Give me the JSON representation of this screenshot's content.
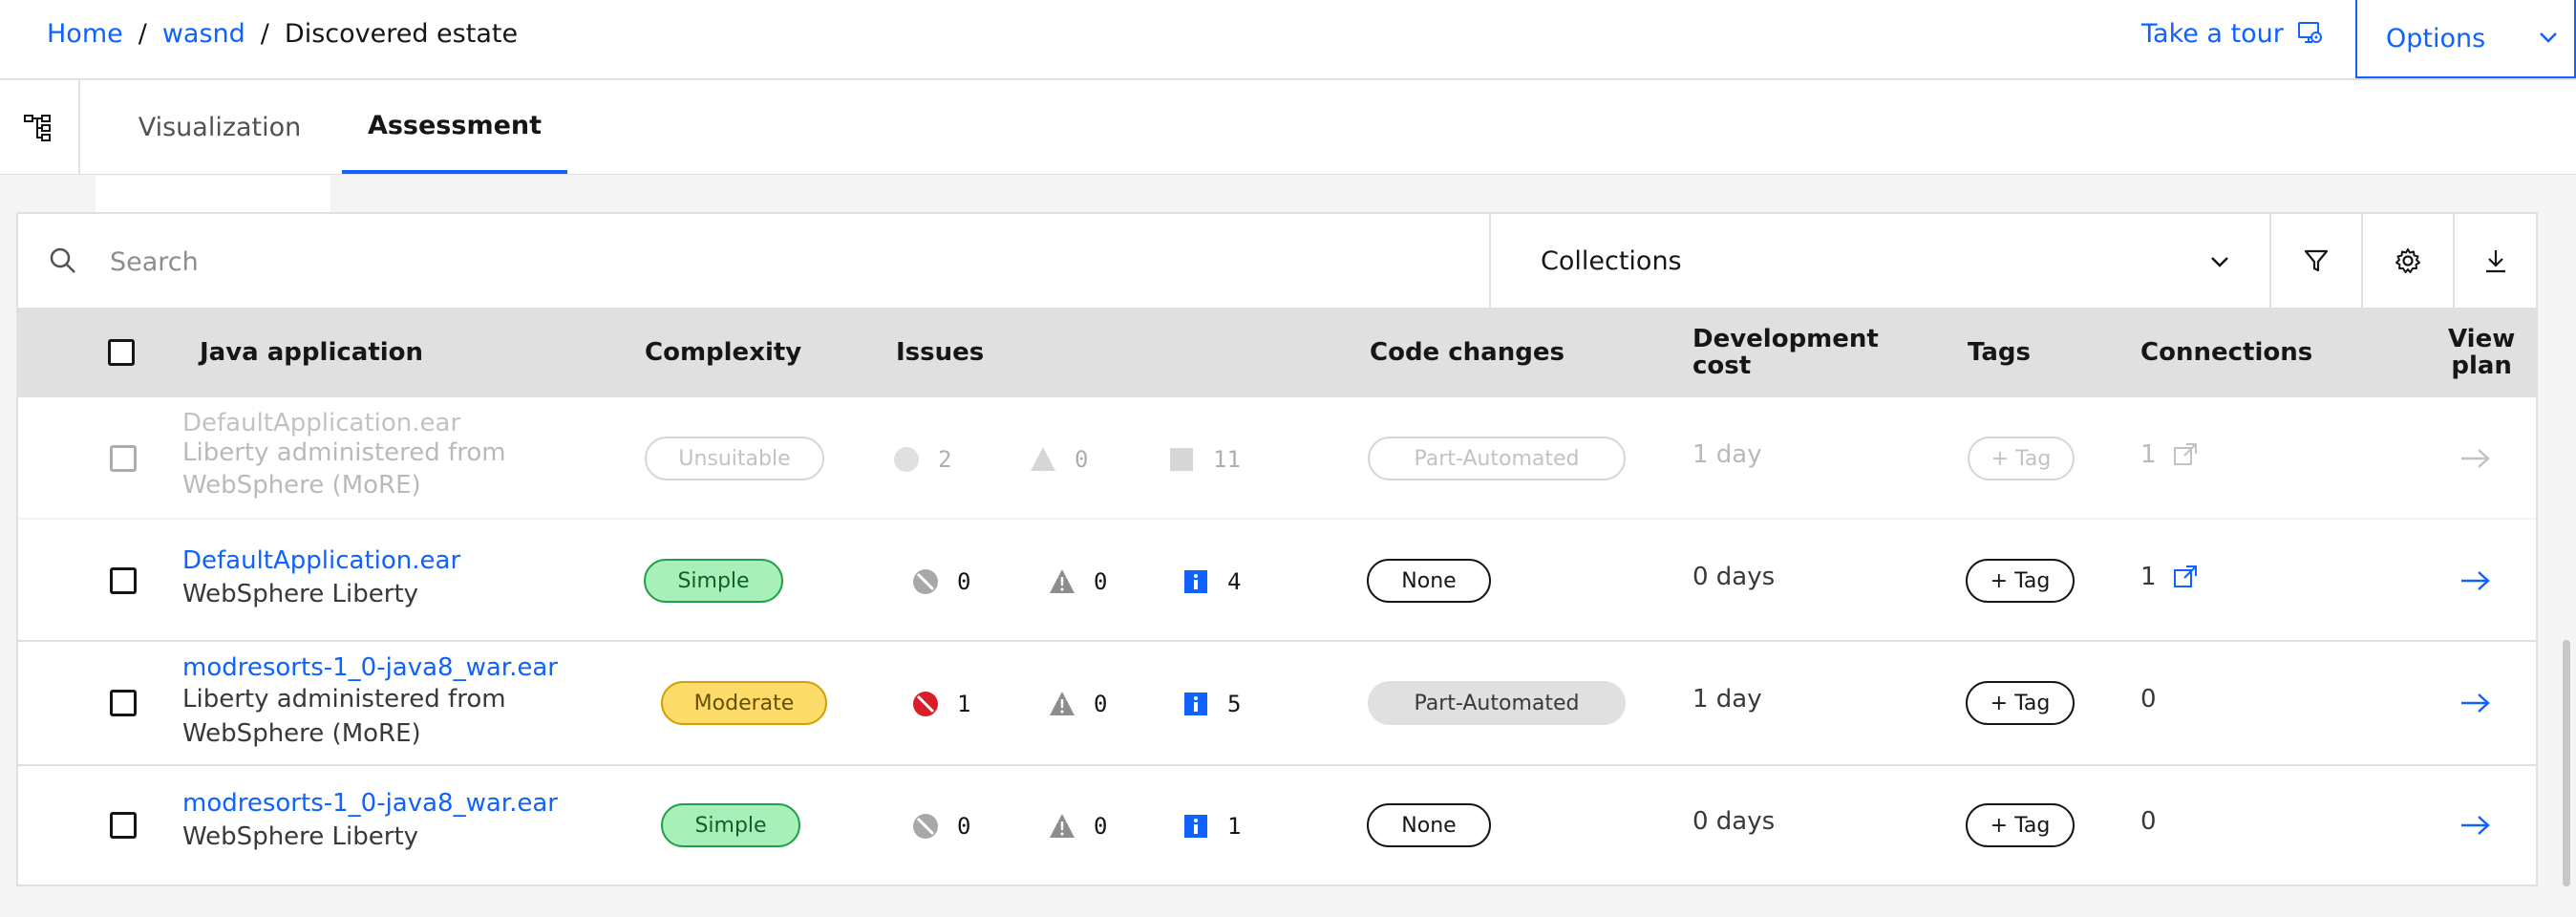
{
  "breadcrumb": {
    "home": "Home",
    "project": "wasnd",
    "current": "Discovered estate"
  },
  "header": {
    "tour_label": "Take a tour",
    "options_label": "Options"
  },
  "tabs": {
    "visualization": "Visualization",
    "assessment": "Assessment"
  },
  "toolbar": {
    "search_placeholder": "Search",
    "collections_label": "Collections"
  },
  "columns": {
    "app": "Java application",
    "complexity": "Complexity",
    "issues": "Issues",
    "code_changes": "Code changes",
    "dev_cost_1": "Development",
    "dev_cost_2": "cost",
    "tags": "Tags",
    "connections": "Connections",
    "view_plan_1": "View",
    "view_plan_2": "plan"
  },
  "rows": [
    {
      "name": "DefaultApplication.ear",
      "sub1": "Liberty administered from",
      "sub2": "WebSphere (MoRE)",
      "complexity": "Unsuitable",
      "critical": "2",
      "warning": "0",
      "info": "11",
      "code_changes": "Part-Automated",
      "cost": "1 day",
      "tag": "+ Tag",
      "connections": "1",
      "disabled": true
    },
    {
      "name": "DefaultApplication.ear",
      "sub1": "WebSphere Liberty",
      "complexity": "Simple",
      "critical": "0",
      "warning": "0",
      "info": "4",
      "code_changes": "None",
      "cost": "0 days",
      "tag": "+ Tag",
      "connections": "1"
    },
    {
      "name": "modresorts-1_0-java8_war.ear",
      "sub1": "Liberty administered from",
      "sub2": "WebSphere (MoRE)",
      "complexity": "Moderate",
      "critical": "1",
      "warning": "0",
      "info": "5",
      "code_changes": "Part-Automated",
      "cost": "1 day",
      "tag": "+ Tag",
      "connections": "0"
    },
    {
      "name": "modresorts-1_0-java8_war.ear",
      "sub1": "WebSphere Liberty",
      "complexity": "Simple",
      "critical": "0",
      "warning": "0",
      "info": "1",
      "code_changes": "None",
      "cost": "0 days",
      "tag": "+ Tag",
      "connections": "0"
    }
  ],
  "colors": {
    "accent": "#0f62fe",
    "simple": "#a7f0ba",
    "moderate": "#fddc69",
    "critical": "#da1e28"
  }
}
